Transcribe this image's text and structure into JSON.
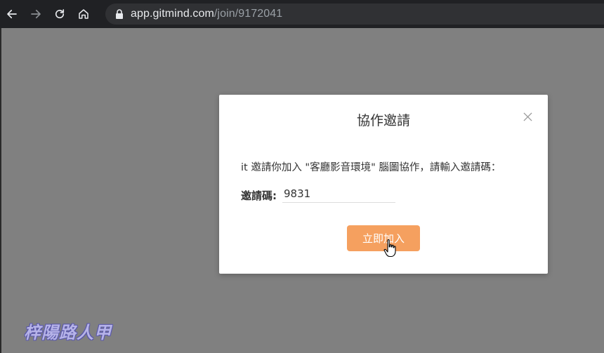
{
  "browser": {
    "url_host": "app.gitmind.com",
    "url_path": "/join/9172041"
  },
  "modal": {
    "title": "協作邀請",
    "invite_message": "it 邀請你加入 \"客廳影音環境\" 腦圖協作，請輸入邀請碼：",
    "code_label": "邀請碼:",
    "code_value": "9831",
    "join_button_label": "立即加入"
  },
  "watermark": {
    "text": "梓陽路人甲"
  },
  "colors": {
    "browser_bar": "#202124",
    "overlay": "#808080",
    "join_button": "#f5a05f",
    "watermark": "#b6b3e8"
  },
  "icons": {
    "back": "arrow-left-icon",
    "forward": "arrow-right-icon",
    "reload": "reload-icon",
    "home": "home-icon",
    "lock": "lock-icon",
    "close": "close-icon",
    "cursor": "hand-pointer-icon"
  }
}
